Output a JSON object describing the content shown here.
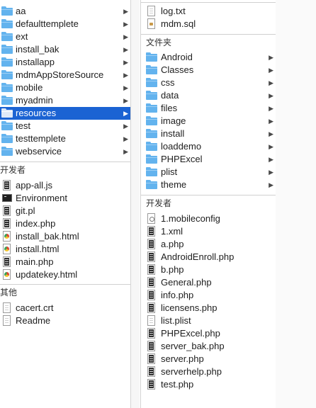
{
  "column1": {
    "folders": [
      {
        "name": "aa"
      },
      {
        "name": "defaulttemplete"
      },
      {
        "name": "ext"
      },
      {
        "name": "install_bak"
      },
      {
        "name": "installapp"
      },
      {
        "name": "mdmAppStoreSource"
      },
      {
        "name": "mobile"
      },
      {
        "name": "myadmin"
      },
      {
        "name": "resources",
        "selected": true
      },
      {
        "name": "test"
      },
      {
        "name": "testtemplete"
      },
      {
        "name": "webservice"
      }
    ],
    "developer_header": "开发者",
    "developer_files": [
      {
        "name": "app-all.js",
        "icon": "script-file-icon"
      },
      {
        "name": "Environment",
        "icon": "terminal-icon"
      },
      {
        "name": "git.pl",
        "icon": "script-file-icon"
      },
      {
        "name": "index.php",
        "icon": "script-file-icon"
      },
      {
        "name": "install_bak.html",
        "icon": "chrome-html-icon"
      },
      {
        "name": "install.html",
        "icon": "chrome-html-icon"
      },
      {
        "name": "main.php",
        "icon": "script-file-icon"
      },
      {
        "name": "updatekey.html",
        "icon": "chrome-html-icon"
      }
    ],
    "other_header": "其他",
    "other_files": [
      {
        "name": "cacert.crt",
        "icon": "blank-file-icon"
      },
      {
        "name": "Readme",
        "icon": "blank-file-icon"
      }
    ]
  },
  "column2": {
    "top_files": [
      {
        "name": "log.txt",
        "icon": "text-file-icon"
      },
      {
        "name": "mdm.sql",
        "icon": "sql-file-icon"
      }
    ],
    "folder_header": "文件夹",
    "folders": [
      {
        "name": "Android"
      },
      {
        "name": "Classes"
      },
      {
        "name": "css"
      },
      {
        "name": "data"
      },
      {
        "name": "files"
      },
      {
        "name": "image"
      },
      {
        "name": "install"
      },
      {
        "name": "loaddemo"
      },
      {
        "name": "PHPExcel"
      },
      {
        "name": "plist"
      },
      {
        "name": "theme"
      }
    ],
    "developer_header": "开发者",
    "developer_files": [
      {
        "name": "1.mobileconfig",
        "icon": "config-file-icon"
      },
      {
        "name": "1.xml",
        "icon": "script-file-icon"
      },
      {
        "name": "a.php",
        "icon": "script-file-icon"
      },
      {
        "name": "AndroidEnroll.php",
        "icon": "script-file-icon"
      },
      {
        "name": "b.php",
        "icon": "script-file-icon"
      },
      {
        "name": "General.php",
        "icon": "script-file-icon"
      },
      {
        "name": "info.php",
        "icon": "script-file-icon"
      },
      {
        "name": "licensens.php",
        "icon": "script-file-icon"
      },
      {
        "name": "list.plist",
        "icon": "plist-file-icon"
      },
      {
        "name": "PHPExcel.php",
        "icon": "script-file-icon"
      },
      {
        "name": "server_bak.php",
        "icon": "script-file-icon"
      },
      {
        "name": "server.php",
        "icon": "script-file-icon"
      },
      {
        "name": "serverhelp.php",
        "icon": "script-file-icon"
      },
      {
        "name": "test.php",
        "icon": "script-file-icon"
      }
    ]
  },
  "colors": {
    "selection": "#1b63d3",
    "folder": "#63b3ee"
  }
}
